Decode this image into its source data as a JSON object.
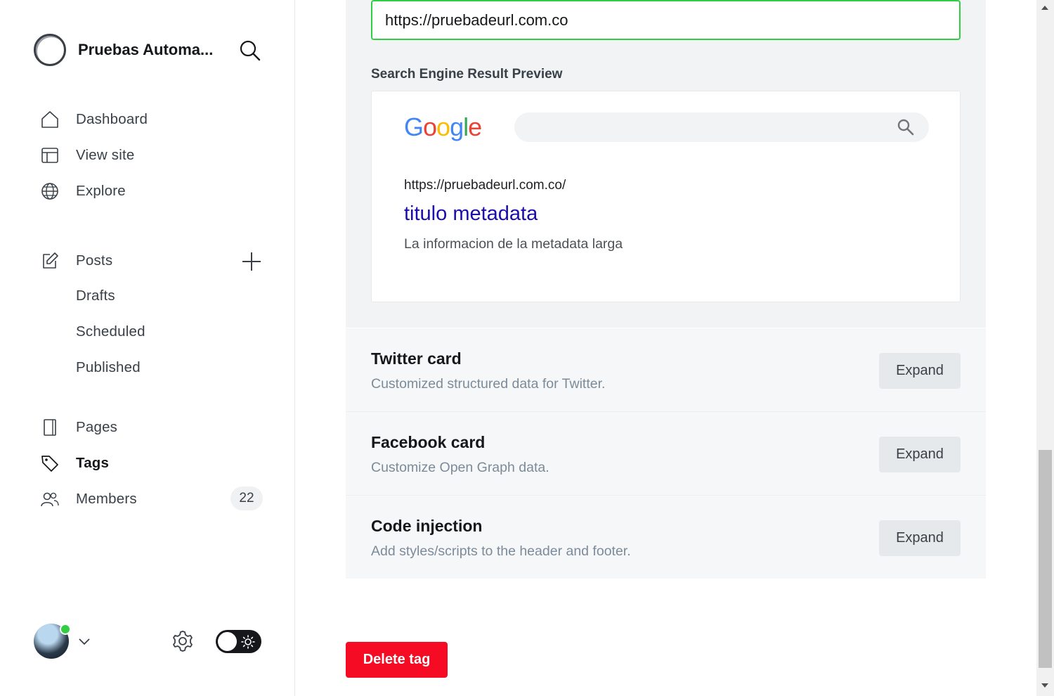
{
  "sidebar": {
    "site_title": "Pruebas Automa...",
    "nav_main": [
      {
        "label": "Dashboard",
        "icon": "home-icon"
      },
      {
        "label": "View site",
        "icon": "layout-icon"
      },
      {
        "label": "Explore",
        "icon": "globe-icon"
      }
    ],
    "posts": {
      "label": "Posts",
      "icon": "edit-icon"
    },
    "post_subitems": [
      "Drafts",
      "Scheduled",
      "Published"
    ],
    "nav_secondary": [
      {
        "label": "Pages",
        "icon": "page-icon"
      },
      {
        "label": "Tags",
        "icon": "tag-icon",
        "active": true
      },
      {
        "label": "Members",
        "icon": "members-icon"
      }
    ],
    "members_count": "22"
  },
  "meta": {
    "canonical_url_value": "https://pruebadeurl.com.co",
    "serp_label": "Search Engine Result Preview",
    "serp": {
      "url": "https://pruebadeurl.com.co/",
      "title": "titulo metadata",
      "description": "La informacion de la metadata larga"
    }
  },
  "sections": [
    {
      "title": "Twitter card",
      "desc": "Customized structured data for Twitter.",
      "button": "Expand"
    },
    {
      "title": "Facebook card",
      "desc": "Customize Open Graph data.",
      "button": "Expand"
    },
    {
      "title": "Code injection",
      "desc": "Add styles/scripts to the header and footer.",
      "button": "Expand"
    }
  ],
  "delete_label": "Delete tag",
  "colors": {
    "accent_green": "#30cf43",
    "danger": "#f50b23",
    "link_blue": "#1a0dab"
  }
}
